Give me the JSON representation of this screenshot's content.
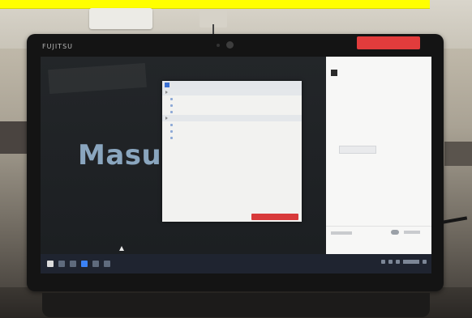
{
  "brand": {
    "logo_text": "FUJITSU"
  },
  "slide": {
    "title_text": "Masuk"
  },
  "colors": {
    "banner": "#ffff00",
    "record_badge": "#e23c3c",
    "dialog_primary": "#d83a3a",
    "taskbar": "#1f2430",
    "slide_title": "#8aa6bf"
  },
  "icons": {
    "webcam": "camera-icon",
    "start": "windows-start-icon",
    "cursor": "mouse-pointer-icon"
  }
}
